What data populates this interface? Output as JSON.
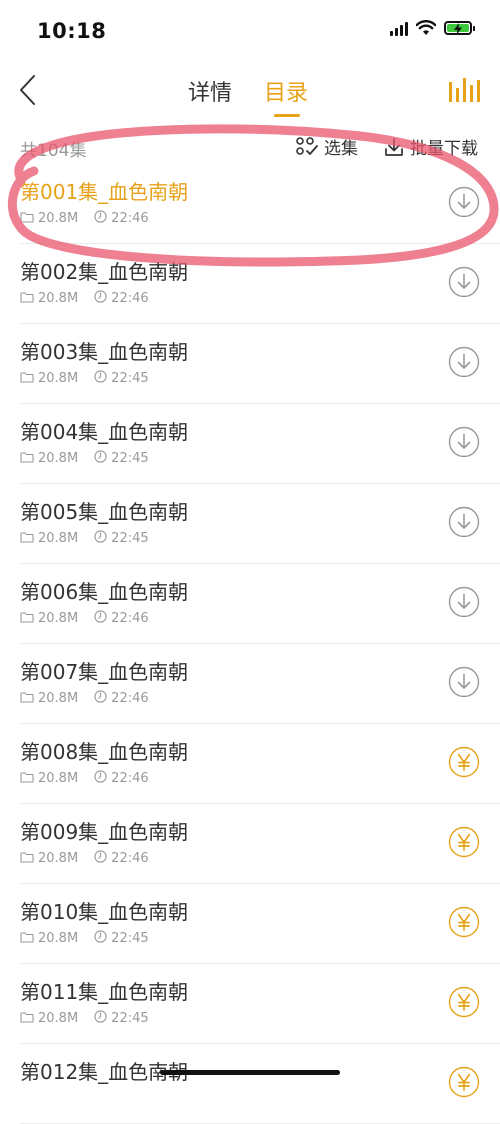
{
  "status_bar": {
    "time": "10:18"
  },
  "nav": {
    "tab_details": "详情",
    "tab_catalog": "目录"
  },
  "toolbar": {
    "total": "共104集",
    "select": "选集",
    "batch_download": "批量下载"
  },
  "colors": {
    "accent": "#e8a21a",
    "annotation": "#e8566e",
    "muted": "#999999"
  },
  "episodes": [
    {
      "title": "第001集_血色南朝",
      "size": "20.8M",
      "duration": "22:46",
      "action": "download-icon",
      "playing": true
    },
    {
      "title": "第002集_血色南朝",
      "size": "20.8M",
      "duration": "22:46",
      "action": "download-icon"
    },
    {
      "title": "第003集_血色南朝",
      "size": "20.8M",
      "duration": "22:45",
      "action": "download-icon"
    },
    {
      "title": "第004集_血色南朝",
      "size": "20.8M",
      "duration": "22:45",
      "action": "download-icon"
    },
    {
      "title": "第005集_血色南朝",
      "size": "20.8M",
      "duration": "22:45",
      "action": "download-icon"
    },
    {
      "title": "第006集_血色南朝",
      "size": "20.8M",
      "duration": "22:46",
      "action": "download-icon"
    },
    {
      "title": "第007集_血色南朝",
      "size": "20.8M",
      "duration": "22:46",
      "action": "download-icon"
    },
    {
      "title": "第008集_血色南朝",
      "size": "20.8M",
      "duration": "22:46",
      "action": "yen-icon"
    },
    {
      "title": "第009集_血色南朝",
      "size": "20.8M",
      "duration": "22:46",
      "action": "yen-icon"
    },
    {
      "title": "第010集_血色南朝",
      "size": "20.8M",
      "duration": "22:45",
      "action": "yen-icon"
    },
    {
      "title": "第011集_血色南朝",
      "size": "20.8M",
      "duration": "22:45",
      "action": "yen-icon"
    },
    {
      "title": "第012集_血色南朝",
      "size": "",
      "duration": "",
      "action": "yen-icon"
    }
  ]
}
